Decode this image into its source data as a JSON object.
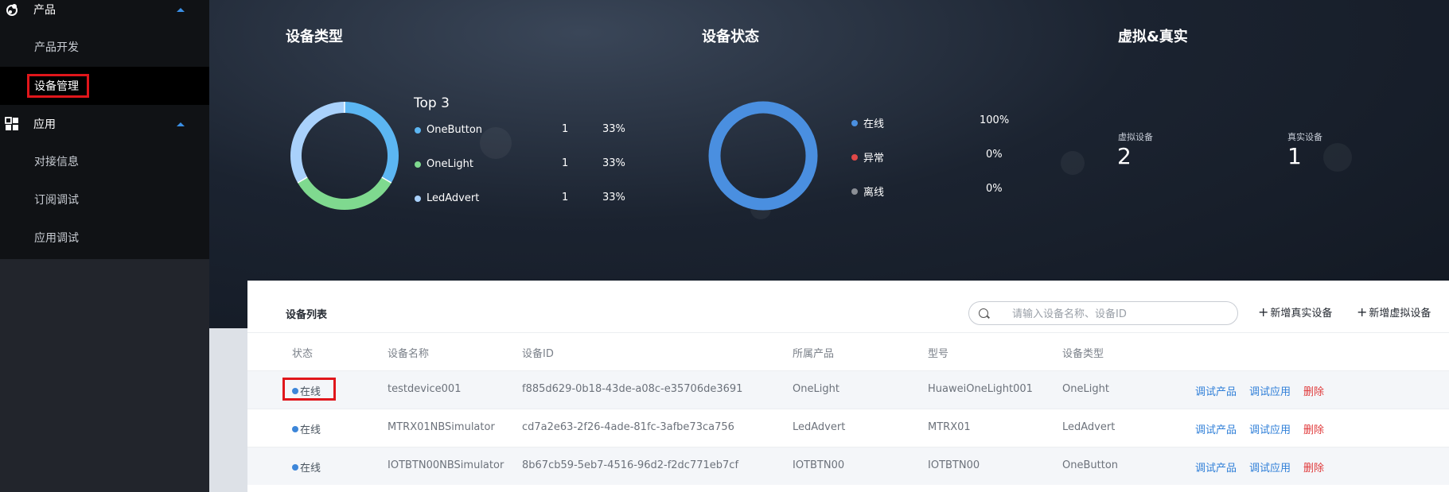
{
  "sidebar": {
    "groups": [
      {
        "label": "产品",
        "items": [
          "产品开发",
          "设备管理"
        ]
      },
      {
        "label": "应用",
        "items": [
          "对接信息",
          "订阅调试",
          "应用调试"
        ]
      }
    ],
    "active_item": "设备管理"
  },
  "dashboard": {
    "device_type": {
      "title": "设备类型",
      "legend_title": "Top 3",
      "rows": [
        {
          "name": "OneButton",
          "count": "1",
          "pct": "33%",
          "color": "#5cb6f2"
        },
        {
          "name": "OneLight",
          "count": "1",
          "pct": "33%",
          "color": "#7fd98f"
        },
        {
          "name": "LedAdvert",
          "count": "1",
          "pct": "33%",
          "color": "#a9d1fb"
        }
      ]
    },
    "device_status": {
      "title": "设备状态",
      "rows": [
        {
          "name": "在线",
          "pct": "100%",
          "color": "#4a8fe0"
        },
        {
          "name": "异常",
          "pct": "0%",
          "color": "#e04848"
        },
        {
          "name": "离线",
          "pct": "0%",
          "color": "#8b8f96"
        }
      ]
    },
    "virtual_real": {
      "title": "虚拟&真实",
      "virtual_label": "虚拟设备",
      "virtual_value": "2",
      "real_label": "真实设备",
      "real_value": "1"
    }
  },
  "device_list": {
    "title": "设备列表",
    "search_placeholder": "请输入设备名称、设备ID",
    "add_real": "新增真实设备",
    "add_virtual": "新增虚拟设备",
    "columns": [
      "状态",
      "设备名称",
      "设备ID",
      "所属产品",
      "型号",
      "设备类型"
    ],
    "rows": [
      {
        "status": "在线",
        "name": "testdevice001",
        "id": "f885d629-0b18-43de-a08c-e35706de3691",
        "product": "OneLight",
        "model": "HuaweiOneLight001",
        "type": "OneLight"
      },
      {
        "status": "在线",
        "name": "MTRX01NBSimulator",
        "id": "cd7a2e63-2f26-4ade-81fc-3afbe73ca756",
        "product": "LedAdvert",
        "model": "MTRX01",
        "type": "LedAdvert"
      },
      {
        "status": "在线",
        "name": "IOTBTN00NBSimulator",
        "id": "8b67cb59-5eb7-4516-96d2-f2dc771eb7cf",
        "product": "IOTBTN00",
        "model": "IOTBTN00",
        "type": "OneButton"
      }
    ],
    "actions": {
      "debug_product": "调试产品",
      "debug_app": "调试应用",
      "delete": "删除"
    }
  }
}
